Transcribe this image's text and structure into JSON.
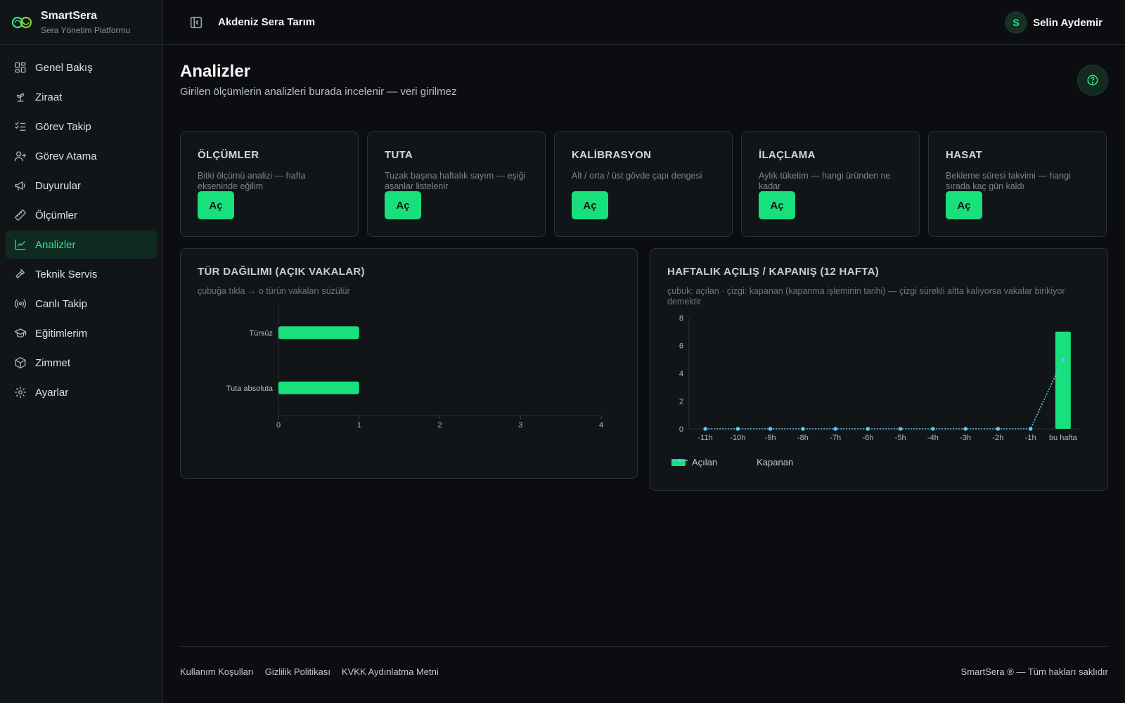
{
  "app": {
    "name": "SmartSera",
    "subtitle": "Sera Yönetim Platformu",
    "org": "Akdeniz Sera Tarım"
  },
  "user": {
    "initial": "S",
    "name": "Selin Aydemir"
  },
  "sidebar": {
    "items": [
      {
        "label": "Genel Bakış",
        "icon": "dashboard-icon",
        "active": false
      },
      {
        "label": "Ziraat",
        "icon": "sprout-icon",
        "active": false
      },
      {
        "label": "Görev Takip",
        "icon": "list-check-icon",
        "active": false
      },
      {
        "label": "Görev Atama",
        "icon": "user-plus-icon",
        "active": false
      },
      {
        "label": "Duyurular",
        "icon": "megaphone-icon",
        "active": false
      },
      {
        "label": "Ölçümler",
        "icon": "ruler-icon",
        "active": false
      },
      {
        "label": "Analizler",
        "icon": "chart-line-icon",
        "active": true
      },
      {
        "label": "Teknik Servis",
        "icon": "hammer-icon",
        "active": false
      },
      {
        "label": "Canlı Takip",
        "icon": "radio-icon",
        "active": false
      },
      {
        "label": "Eğitimlerim",
        "icon": "graduation-cap-icon",
        "active": false
      },
      {
        "label": "Zimmet",
        "icon": "package-icon",
        "active": false
      },
      {
        "label": "Ayarlar",
        "icon": "gear-icon",
        "active": false
      }
    ]
  },
  "page": {
    "title": "Analizler",
    "subtitle": "Girilen ölçümlerin analizleri burada incelenir — veri girilmez"
  },
  "cards": [
    {
      "title": "ÖLÇÜMLER",
      "desc": "Bitki ölçümü analizi — hafta ekseninde eğilim",
      "button": "Aç"
    },
    {
      "title": "TUTA",
      "desc": "Tuzak başına haftalık sayım — eşiği aşanlar listelenir",
      "button": "Aç"
    },
    {
      "title": "KALİBRASYON",
      "desc": "Alt / orta / üst gövde çapı dengesi",
      "button": "Aç"
    },
    {
      "title": "İLAÇLAMA",
      "desc": "Aylık tüketim — hangi üründen ne kadar",
      "button": "Aç"
    },
    {
      "title": "HASAT",
      "desc": "Bekleme süresi takvimi — hangi sırada kaç gün kaldı",
      "button": "Aç"
    }
  ],
  "panels": {
    "left": {
      "title": "TÜR DAĞILIMI (AÇIK VAKALAR)",
      "subtitle": "çubuğa tıkla → o türün vakaları süzülür"
    },
    "right": {
      "title": "HAFTALIK AÇILIŞ / KAPANIŞ (12 HAFTA)",
      "subtitle": "çubuk: açılan · çizgi: kapanan (kapanma işleminin tarihi) — çizgi sürekli altta kalıyorsa vakalar birikiyor demektir"
    }
  },
  "chart_data": [
    {
      "type": "bar",
      "orientation": "horizontal",
      "categories": [
        "Türsüz",
        "Tuta absoluta"
      ],
      "values": [
        1,
        1
      ],
      "xlim": [
        0,
        4
      ],
      "xticks": [
        "0",
        "1",
        "2",
        "3",
        "4"
      ],
      "colors": {
        "bar": "#17e07c"
      }
    },
    {
      "type": "bar",
      "categories": [
        "-11h",
        "-10h",
        "-9h",
        "-8h",
        "-7h",
        "-6h",
        "-5h",
        "-4h",
        "-3h",
        "-2h",
        "-1h",
        "bu hafta"
      ],
      "ylim": [
        0,
        8
      ],
      "yticks": [
        "0",
        "2",
        "4",
        "6",
        "8"
      ],
      "series": [
        {
          "name": "Açılan",
          "kind": "bar",
          "color": "#17e07c",
          "values": [
            0,
            0,
            0,
            0,
            0,
            0,
            0,
            0,
            0,
            0,
            0,
            7
          ]
        },
        {
          "name": "Kapanan",
          "kind": "line",
          "style": "dotted",
          "color": "#5cc8f0",
          "values": [
            0,
            0,
            0,
            0,
            0,
            0,
            0,
            0,
            0,
            0,
            0,
            5
          ]
        }
      ],
      "legend": "bottom-left"
    }
  ],
  "footer": {
    "links": [
      "Kullanım Koşulları",
      "Gizlilik Politikası",
      "KVKK Aydınlatma Metni"
    ],
    "copyright": "SmartSera ® — Tüm hakları saklıdır"
  }
}
